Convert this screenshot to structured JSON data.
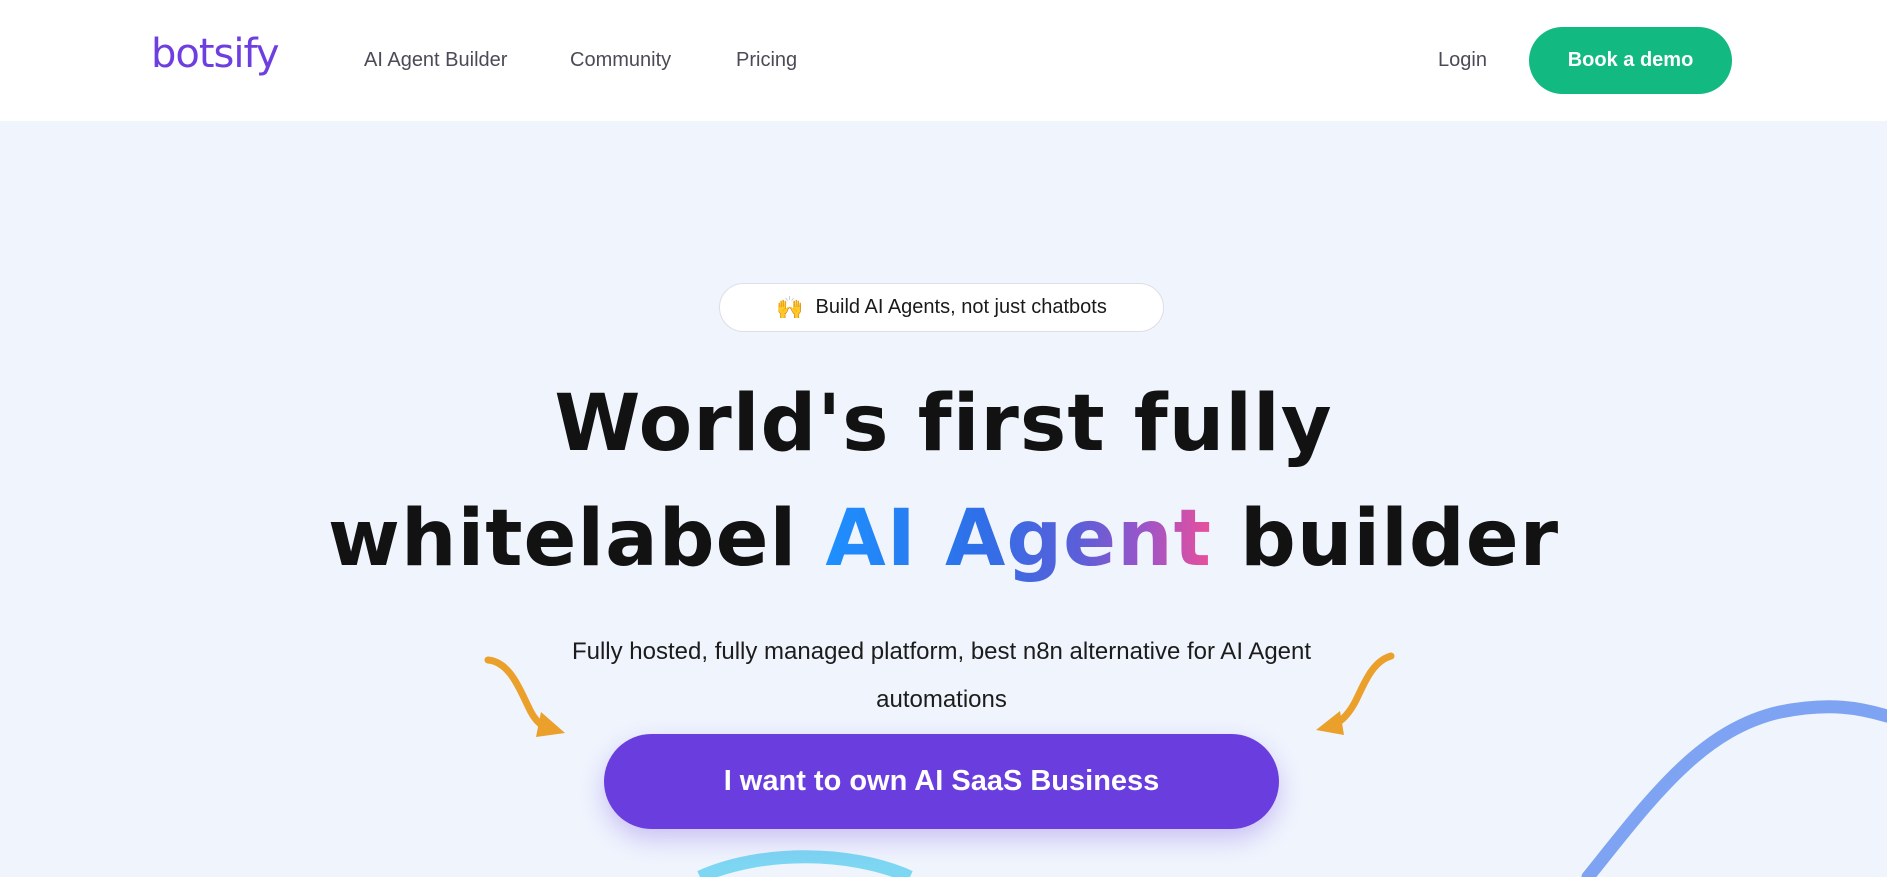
{
  "brand": {
    "logo_text": "botsify",
    "accent": "#6d3fe0"
  },
  "nav": {
    "links": [
      "AI Agent Builder",
      "Community",
      "Pricing"
    ],
    "login": "Login",
    "demo_button": "Book a demo",
    "demo_color": "#12b981"
  },
  "hero": {
    "badge_emoji": "🙌",
    "badge_text": "Build AI Agents, not just chatbots",
    "headline_line1": "World's first fully",
    "headline_line2_prefix": "whitelabel",
    "headline_highlight": "AI Agent",
    "headline_line2_suffix": "builder",
    "subtitle": "Fully hosted, fully managed platform, best n8n alternative for AI Agent automations",
    "cta_label": "I want to own AI SaaS Business",
    "cta_color": "#6a3ddf",
    "arrow_icon": "curved-arrow-icon"
  }
}
